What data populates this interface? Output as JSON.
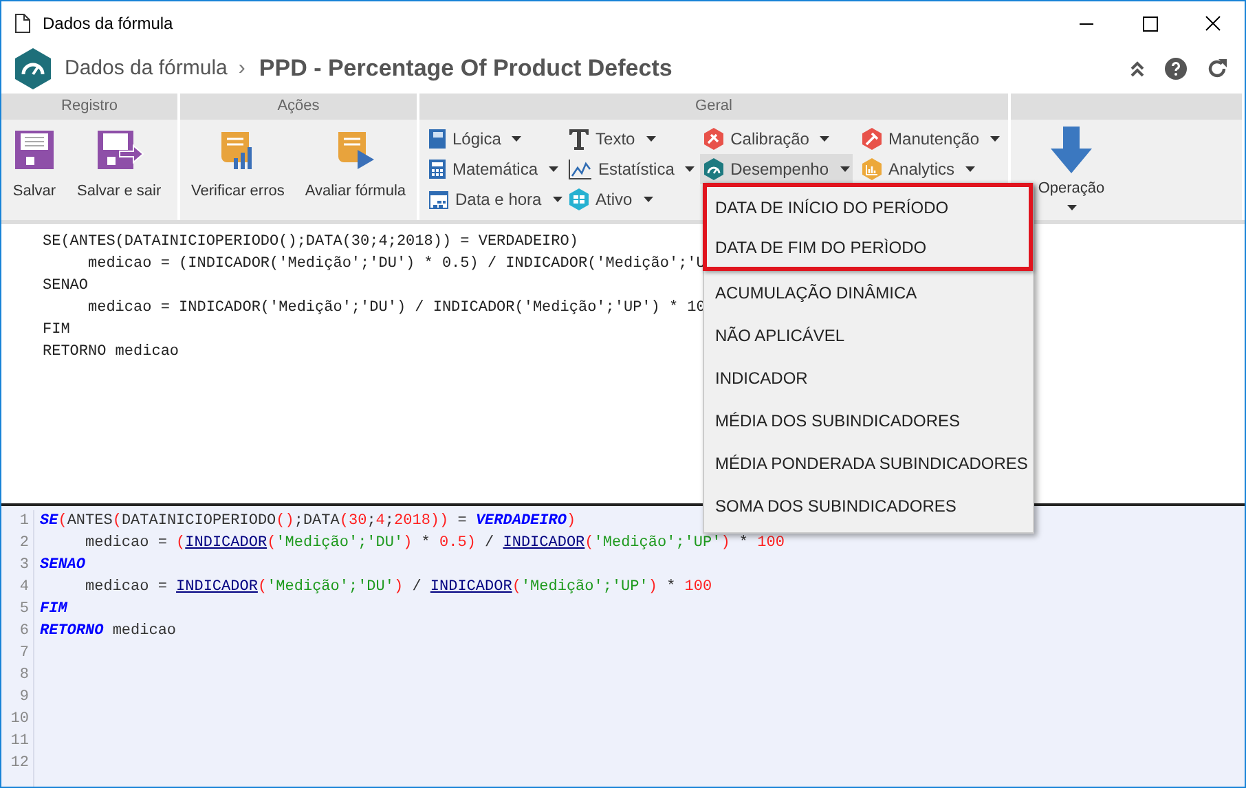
{
  "window": {
    "title": "Dados da fórmula"
  },
  "header": {
    "breadcrumb": "Dados da fórmula",
    "separator": "›",
    "title": "PPD - Percentage Of Product Defects"
  },
  "ribbon": {
    "groups": [
      {
        "title": "Registro",
        "kind": "large",
        "buttons": [
          {
            "label": "Salvar"
          },
          {
            "label": "Salvar e sair"
          }
        ]
      },
      {
        "title": "Ações",
        "kind": "large",
        "buttons": [
          {
            "label": "Verificar erros"
          },
          {
            "label": "Avaliar fórmula"
          }
        ]
      },
      {
        "title": "Geral",
        "kind": "menus",
        "columns": [
          [
            {
              "label": "Lógica",
              "selected": false
            },
            {
              "label": "Matemática",
              "selected": false
            },
            {
              "label": "Data e hora",
              "selected": false
            }
          ],
          [
            {
              "label": "Texto",
              "selected": false
            },
            {
              "label": "Estatística",
              "selected": false
            },
            {
              "label": "Ativo",
              "selected": false
            }
          ],
          [
            {
              "label": "Calibração",
              "selected": false
            },
            {
              "label": "Desempenho",
              "selected": true
            }
          ],
          [
            {
              "label": "Manutenção",
              "selected": false
            },
            {
              "label": "Analytics",
              "selected": false
            }
          ]
        ]
      },
      {
        "kind": "operation",
        "buttons": [
          {
            "label": "Operação"
          }
        ]
      }
    ]
  },
  "editor_top": {
    "lines": [
      "SE(ANTES(DATAINICIOPERIODO();DATA(30;4;2018)) = VERDADEIRO)",
      "     medicao = (INDICADOR('Medição';'DU') * 0.5) / INDICADOR('Medição';'U",
      "SENAO",
      "     medicao = INDICADOR('Medição';'DU') / INDICADOR('Medição';'UP') * 10",
      "FIM",
      "RETORNO medicao"
    ]
  },
  "dropdown": {
    "items": [
      {
        "label": "DATA DE INÍCIO DO PERÍODO",
        "boxed": true
      },
      {
        "label": "DATA DE FIM DO PERÌODO",
        "boxed": true
      },
      {
        "label": "ACUMULAÇÃO DINÂMICA",
        "boxed": false
      },
      {
        "label": "NÃO APLICÁVEL",
        "boxed": false
      },
      {
        "label": "INDICADOR",
        "boxed": false
      },
      {
        "label": "MÉDIA DOS SUBINDICADORES",
        "boxed": false
      },
      {
        "label": "MÉDIA PONDERADA SUBINDICADORES",
        "boxed": false
      },
      {
        "label": "SOMA DOS SUBINDICADORES",
        "boxed": false
      }
    ]
  },
  "editor_bottom": {
    "line_numbers": [
      "1",
      "2",
      "3",
      "4",
      "5",
      "6",
      "7",
      "8",
      "9",
      "10",
      "11",
      "12"
    ],
    "lines": [
      [
        {
          "kind": "keyword",
          "text": "SE"
        },
        {
          "kind": "paren",
          "text": "("
        },
        {
          "kind": "plain",
          "text": "ANTES"
        },
        {
          "kind": "paren",
          "text": "("
        },
        {
          "kind": "plain",
          "text": "DATAINICIOPERIODO"
        },
        {
          "kind": "paren",
          "text": "()"
        },
        {
          "kind": "plain",
          "text": ";DATA"
        },
        {
          "kind": "paren",
          "text": "("
        },
        {
          "kind": "number",
          "text": "30"
        },
        {
          "kind": "plain",
          "text": ";"
        },
        {
          "kind": "number",
          "text": "4"
        },
        {
          "kind": "plain",
          "text": ";"
        },
        {
          "kind": "number",
          "text": "2018"
        },
        {
          "kind": "paren",
          "text": "))"
        },
        {
          "kind": "plain",
          "text": " = "
        },
        {
          "kind": "keyword",
          "text": "VERDADEIRO"
        },
        {
          "kind": "paren",
          "text": ")"
        }
      ],
      [
        {
          "kind": "plain",
          "text": "     medicao = "
        },
        {
          "kind": "paren",
          "text": "("
        },
        {
          "kind": "function",
          "text": "INDICADOR"
        },
        {
          "kind": "paren",
          "text": "("
        },
        {
          "kind": "string",
          "text": "'Medição';'DU'"
        },
        {
          "kind": "paren",
          "text": ")"
        },
        {
          "kind": "plain",
          "text": " * "
        },
        {
          "kind": "number",
          "text": "0.5"
        },
        {
          "kind": "paren",
          "text": ")"
        },
        {
          "kind": "plain",
          "text": " / "
        },
        {
          "kind": "function",
          "text": "INDICADOR"
        },
        {
          "kind": "paren",
          "text": "("
        },
        {
          "kind": "string",
          "text": "'Medição';'UP'"
        },
        {
          "kind": "paren",
          "text": ")"
        },
        {
          "kind": "plain",
          "text": " * "
        },
        {
          "kind": "number",
          "text": "100"
        }
      ],
      [
        {
          "kind": "keyword",
          "text": "SENAO"
        }
      ],
      [
        {
          "kind": "plain",
          "text": "     medicao = "
        },
        {
          "kind": "function",
          "text": "INDICADOR"
        },
        {
          "kind": "paren",
          "text": "("
        },
        {
          "kind": "string",
          "text": "'Medição';'DU'"
        },
        {
          "kind": "paren",
          "text": ")"
        },
        {
          "kind": "plain",
          "text": " / "
        },
        {
          "kind": "function",
          "text": "INDICADOR"
        },
        {
          "kind": "paren",
          "text": "("
        },
        {
          "kind": "string",
          "text": "'Medição';'UP'"
        },
        {
          "kind": "paren",
          "text": ")"
        },
        {
          "kind": "plain",
          "text": " * "
        },
        {
          "kind": "number",
          "text": "100"
        }
      ],
      [
        {
          "kind": "keyword",
          "text": "FIM"
        }
      ],
      [
        {
          "kind": "keyword",
          "text": "RETORNO"
        },
        {
          "kind": "plain",
          "text": " medicao"
        }
      ]
    ]
  }
}
